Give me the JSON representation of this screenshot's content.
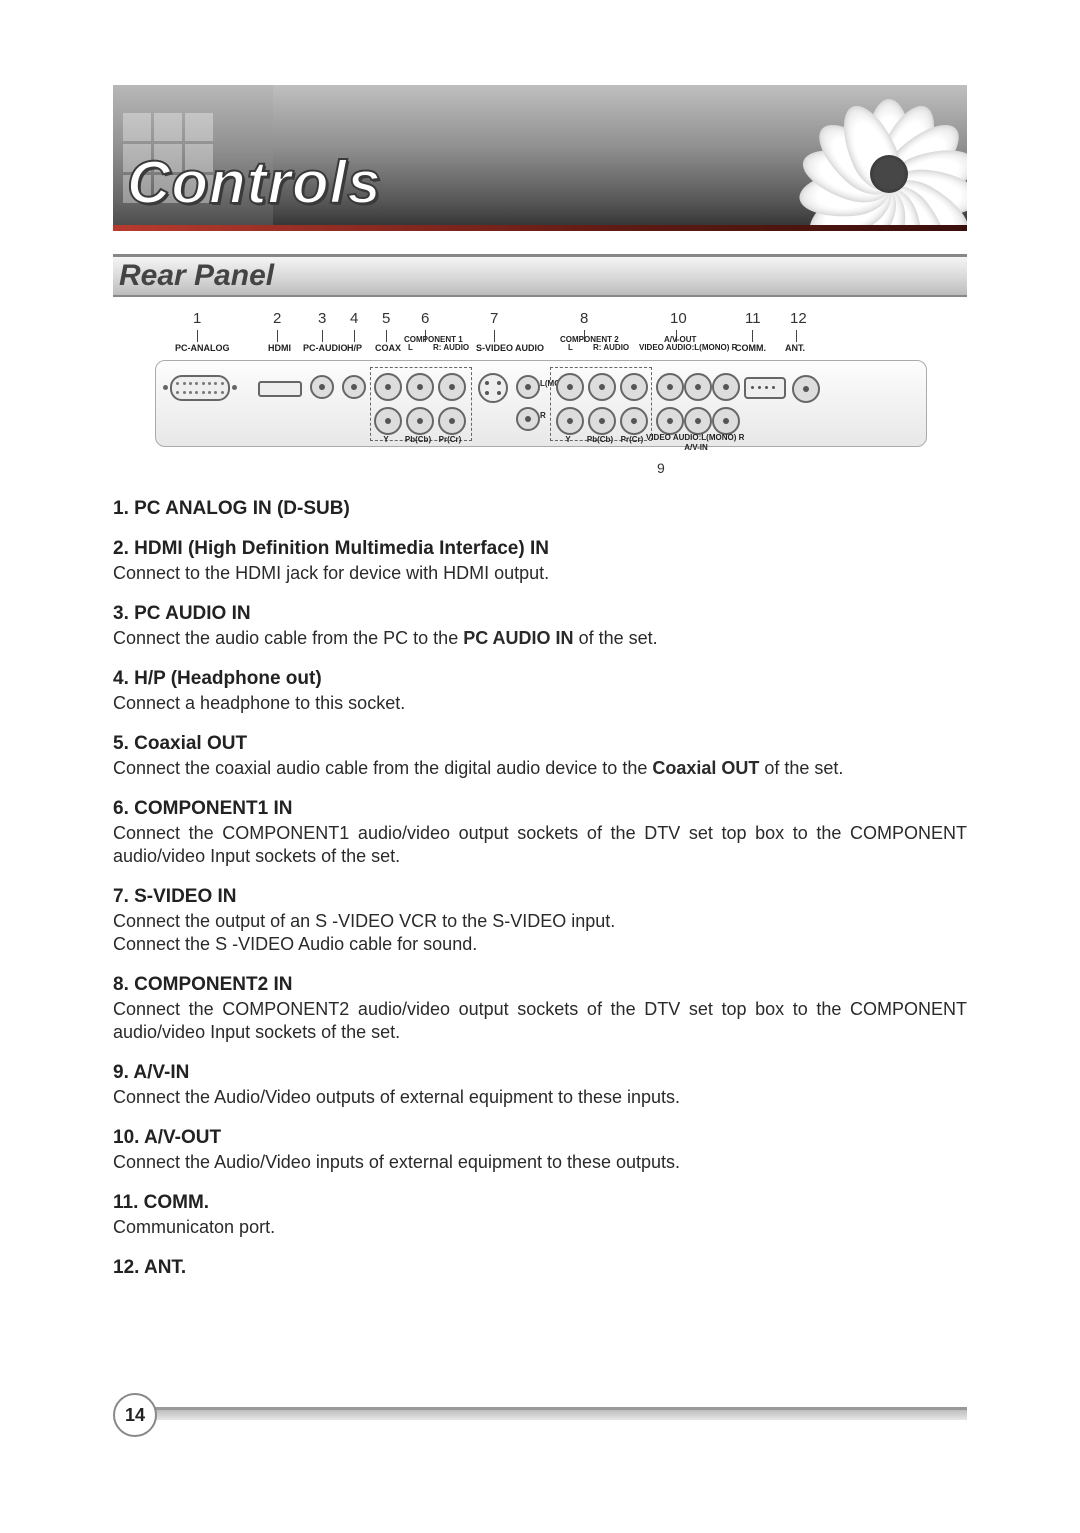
{
  "banner": {
    "title": "Controls"
  },
  "section": {
    "heading": "Rear Panel"
  },
  "diagram": {
    "numbers": [
      "1",
      "2",
      "3",
      "4",
      "5",
      "6",
      "7",
      "8",
      "10",
      "11",
      "12"
    ],
    "below_number": "9",
    "top_labels": {
      "pc_analog": "PC-ANALOG",
      "hdmi": "HDMI",
      "pc_audio": "PC-AUDIO",
      "hp": "H/P",
      "coax": "COAX",
      "comp1_header": "COMPONENT 1",
      "l": "L",
      "r_audio": "R: AUDIO",
      "svideo": "S-VIDEO",
      "audio": "AUDIO",
      "comp2_header": "COMPONENT 2",
      "l2": "L",
      "r_audio2": "R: AUDIO",
      "avout_header": "A/V-OUT",
      "avout_sub": "VIDEO  AUDIO:L(MONO)  R",
      "comm": "COMM.",
      "ant": "ANT."
    },
    "panel_labels": {
      "lmono": "L(MONO)",
      "r": "R",
      "y": "Y",
      "pbcb": "Pb(Cb)",
      "prcr": "Pr(Cr)",
      "y2": "Y",
      "pbcb2": "Pb(Cb)",
      "prcr2": "Pr(Cr)",
      "avin_sub": "VIDEO  AUDIO:L(MONO)  R",
      "avin": "A/V-IN"
    }
  },
  "entries": [
    {
      "heading": "1. PC ANALOG IN (D-SUB)",
      "body": ""
    },
    {
      "heading": "2. HDMI (High Definition Multimedia Interface) IN",
      "body": "Connect to the HDMI jack for device with HDMI output."
    },
    {
      "heading": "3. PC AUDIO IN",
      "body": "Connect the audio cable from the PC to the <strong>PC AUDIO IN</strong> of the set."
    },
    {
      "heading": "4. H/P (Headphone out)",
      "body": "Connect a headphone to this socket."
    },
    {
      "heading": "5. Coaxial OUT",
      "body": "Connect the coaxial audio cable from the digital audio device to the <strong>Coaxial  OUT</strong> of the set."
    },
    {
      "heading": "6. COMPONENT1 IN",
      "body": "Connect the COMPONENT1 audio/video output sockets of the DTV set top box to the COMPONENT audio/video Input sockets of the set."
    },
    {
      "heading": "7. S-VIDEO IN",
      "body": "Connect the output of an S -VIDEO VCR to the S-VIDEO input.\nConnect the S -VIDEO Audio cable for sound."
    },
    {
      "heading": "8. COMPONENT2 IN",
      "body": "Connect the COMPONENT2 audio/video output sockets of the DTV set top box to the COMPONENT audio/video Input sockets of the set."
    },
    {
      "heading": "9. A/V-IN",
      "body": "Connect the Audio/Video outputs of external equipment to these inputs."
    },
    {
      "heading": "10. A/V-OUT",
      "body": "Connect the Audio/Video inputs of external equipment to these outputs."
    },
    {
      "heading": "11. COMM.",
      "body": "Communicaton port."
    },
    {
      "heading": "12. ANT.",
      "body": ""
    }
  ],
  "page_number": "14"
}
